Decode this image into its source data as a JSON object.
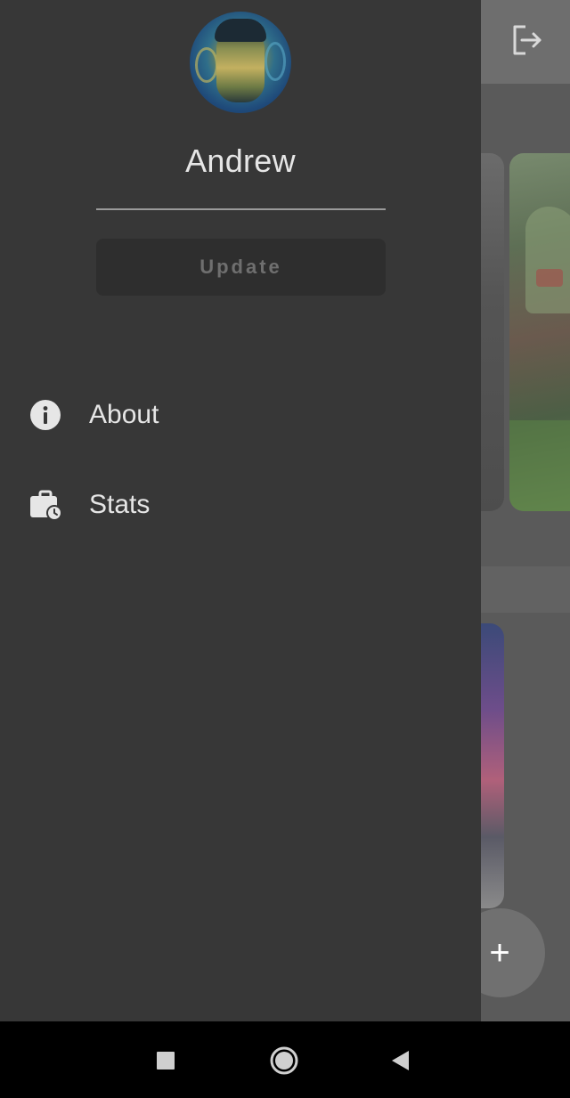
{
  "drawer": {
    "username": "Andrew",
    "update_label": "Update",
    "menu": [
      {
        "label": "About",
        "icon": "info-icon"
      },
      {
        "label": "Stats",
        "icon": "briefcase-clock-icon"
      }
    ]
  },
  "appbar": {
    "action_icon": "logout-icon"
  },
  "fab": {
    "label": "+",
    "icon": "add-icon"
  },
  "system_nav": {
    "recent_icon": "square-icon",
    "home_icon": "circle-icon",
    "back_icon": "triangle-back-icon"
  },
  "colors": {
    "drawer_bg": "#373737",
    "text": "#e6e6e6",
    "update_button_bg": "#2e2e2e",
    "update_button_text": "#6f6f6f",
    "scrim_app_bg": "#5a5a5a"
  }
}
